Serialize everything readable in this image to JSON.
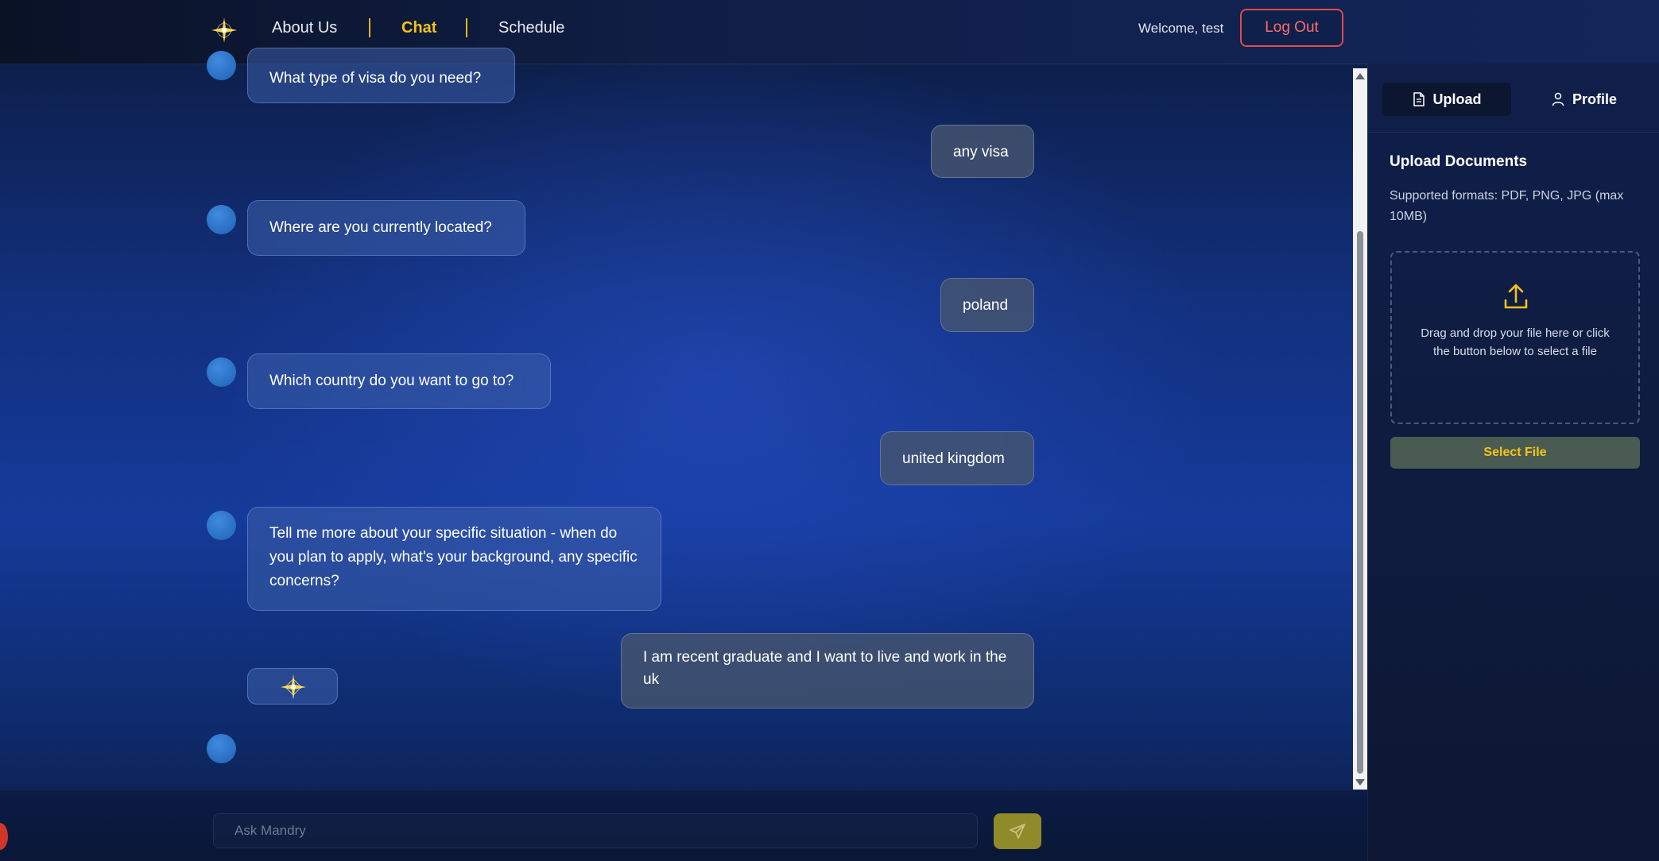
{
  "nav": {
    "links": [
      {
        "label": "About Us"
      },
      {
        "label": "Chat"
      },
      {
        "label": "Schedule"
      }
    ],
    "welcome": "Welcome, test",
    "logout_label": "Log Out"
  },
  "chat": {
    "messages": [
      {
        "role": "bot",
        "text": "What type of visa do you need?"
      },
      {
        "role": "user",
        "text": "any visa"
      },
      {
        "role": "bot",
        "text": "Where are you currently located?"
      },
      {
        "role": "user",
        "text": "poland"
      },
      {
        "role": "bot",
        "text": "Which country do you want to go to?"
      },
      {
        "role": "user",
        "text": "united kingdom"
      },
      {
        "role": "bot",
        "text": "Tell me more about your specific situation - when do you plan to apply, what's your background, any specific concerns?"
      },
      {
        "role": "user",
        "text": "I am recent graduate and I want to live and work in the uk"
      }
    ],
    "typing_indicator": "star-icon",
    "input": {
      "placeholder": "Ask Mandry",
      "value": ""
    }
  },
  "sidebar": {
    "tabs": [
      {
        "label": "Upload",
        "icon": "document-icon",
        "active": true
      },
      {
        "label": "Profile",
        "icon": "user-icon",
        "active": false
      }
    ],
    "title": "Upload Documents",
    "formats": "Supported formats: PDF, PNG, JPG (max 10MB)",
    "dropzone_text": "Drag and drop your file here or click the button below to select a file",
    "select_button": "Select File"
  },
  "colors": {
    "accent": "#f2c21b",
    "logout": "#e24a4a",
    "avatar": "#2f78d1"
  }
}
